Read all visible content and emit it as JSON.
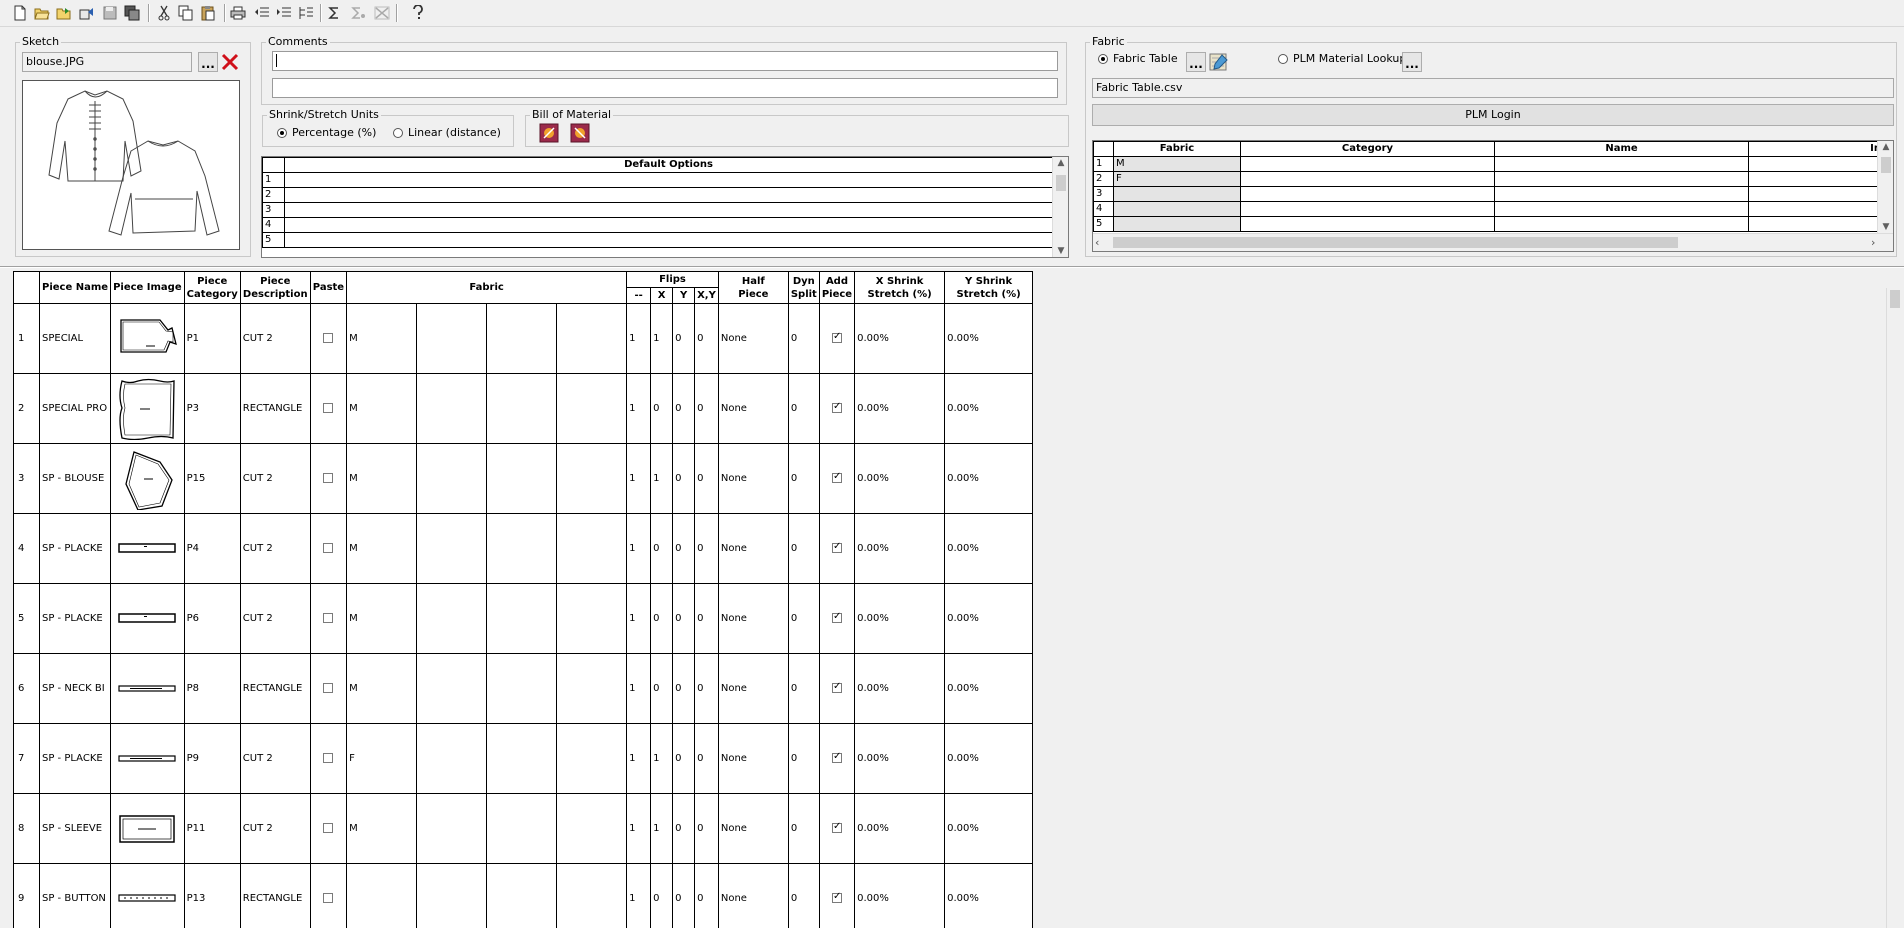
{
  "toolbar": {
    "icons": [
      "new-file-icon",
      "open-folder-icon",
      "open-recent-icon",
      "import-icon",
      "save-icon",
      "save-as-icon",
      "cut-icon",
      "copy-icon",
      "paste-icon",
      "print-icon",
      "indent-left-icon",
      "indent-right-icon",
      "tree-icon",
      "sum-icon",
      "sum-disabled-icon",
      "close-all-disabled-icon",
      "help-icon"
    ]
  },
  "sketch": {
    "legend": "Sketch",
    "file": "blouse.JPG",
    "browse_label": "...",
    "image_name": "blouse-sketch"
  },
  "comments": {
    "legend": "Comments",
    "line1": "",
    "line2": ""
  },
  "shrink": {
    "legend": "Shrink/Stretch Units",
    "options": [
      {
        "label": "Percentage (%)",
        "selected": true
      },
      {
        "label": "Linear (distance)",
        "selected": false
      }
    ]
  },
  "bom": {
    "legend": "Bill of Material",
    "icons": [
      "bom-import-icon",
      "bom-export-icon"
    ]
  },
  "default_options": {
    "header": "Default Options",
    "rows": [
      "1",
      "2",
      "3",
      "4",
      "5"
    ]
  },
  "fabric": {
    "legend": "Fabric",
    "radio_table": "Fabric Table",
    "radio_plm": "PLM Material Lookup",
    "table_selected": true,
    "file": "Fabric Table.csv",
    "plm_login": "PLM Login",
    "browse_label": "...",
    "columns": [
      "Fabric",
      "Category",
      "Name",
      "Ima"
    ],
    "rows": [
      {
        "n": "1",
        "fabric": "M"
      },
      {
        "n": "2",
        "fabric": "F"
      },
      {
        "n": "3",
        "fabric": ""
      },
      {
        "n": "4",
        "fabric": ""
      },
      {
        "n": "5",
        "fabric": ""
      }
    ]
  },
  "main": {
    "headers": {
      "piece_name": "Piece Name",
      "piece_image": "Piece Image",
      "piece_category_1": "Piece",
      "piece_category_2": "Category",
      "piece_description_1": "Piece",
      "piece_description_2": "Description",
      "paste": "Paste",
      "fabric": "Fabric",
      "flips": "Flips",
      "flip_dash": "--",
      "flip_x": "X",
      "flip_y": "Y",
      "flip_xy": "X,Y",
      "half_piece_1": "Half",
      "half_piece_2": "Piece",
      "dyn_split_1": "Dyn",
      "dyn_split_2": "Split",
      "add_piece_1": "Add",
      "add_piece_2": "Piece",
      "x_shrink_1": "X Shrink",
      "x_shrink_2": "Stretch (%)",
      "y_shrink_1": "Y Shrink",
      "y_shrink_2": "Stretch (%)"
    },
    "rows": [
      {
        "n": "1",
        "name": "SPECIAL",
        "shape": "bodice",
        "category": "P1",
        "description": "CUT 2",
        "paste": false,
        "fabric": "M",
        "f1": "1",
        "fx": "1",
        "fy": "0",
        "fxy": "0",
        "half": "None",
        "dyn": "0",
        "add": true,
        "xs": "0.00%",
        "ys": "0.00%"
      },
      {
        "n": "2",
        "name": "SPECIAL PRO",
        "shape": "rect-wavy",
        "category": "P3",
        "description": "RECTANGLE",
        "paste": false,
        "fabric": "M",
        "f1": "1",
        "fx": "0",
        "fy": "0",
        "fxy": "0",
        "half": "None",
        "dyn": "0",
        "add": true,
        "xs": "0.00%",
        "ys": "0.00%"
      },
      {
        "n": "3",
        "name": "SP - BLOUSE",
        "shape": "pentagon",
        "category": "P15",
        "description": "CUT 2",
        "paste": false,
        "fabric": "M",
        "f1": "1",
        "fx": "1",
        "fy": "0",
        "fxy": "0",
        "half": "None",
        "dyn": "0",
        "add": true,
        "xs": "0.00%",
        "ys": "0.00%"
      },
      {
        "n": "4",
        "name": "SP - PLACKE",
        "shape": "strip-thick",
        "category": "P4",
        "description": "CUT 2",
        "paste": false,
        "fabric": "M",
        "f1": "1",
        "fx": "0",
        "fy": "0",
        "fxy": "0",
        "half": "None",
        "dyn": "0",
        "add": true,
        "xs": "0.00%",
        "ys": "0.00%"
      },
      {
        "n": "5",
        "name": "SP - PLACKE",
        "shape": "strip-thick",
        "category": "P6",
        "description": "CUT 2",
        "paste": false,
        "fabric": "M",
        "f1": "1",
        "fx": "0",
        "fy": "0",
        "fxy": "0",
        "half": "None",
        "dyn": "0",
        "add": true,
        "xs": "0.00%",
        "ys": "0.00%"
      },
      {
        "n": "6",
        "name": "SP - NECK BI",
        "shape": "strip-thin",
        "category": "P8",
        "description": "RECTANGLE",
        "paste": false,
        "fabric": "M",
        "f1": "1",
        "fx": "0",
        "fy": "0",
        "fxy": "0",
        "half": "None",
        "dyn": "0",
        "add": true,
        "xs": "0.00%",
        "ys": "0.00%"
      },
      {
        "n": "7",
        "name": "SP - PLACKE",
        "shape": "strip-thin",
        "category": "P9",
        "description": "CUT 2",
        "paste": false,
        "fabric": "F",
        "f1": "1",
        "fx": "1",
        "fy": "0",
        "fxy": "0",
        "half": "None",
        "dyn": "0",
        "add": true,
        "xs": "0.00%",
        "ys": "0.00%"
      },
      {
        "n": "8",
        "name": "SP - SLEEVE",
        "shape": "rect-double",
        "category": "P11",
        "description": "CUT 2",
        "paste": false,
        "fabric": "M",
        "f1": "1",
        "fx": "1",
        "fy": "0",
        "fxy": "0",
        "half": "None",
        "dyn": "0",
        "add": true,
        "xs": "0.00%",
        "ys": "0.00%"
      },
      {
        "n": "9",
        "name": "SP - BUTTON",
        "shape": "strip-dotted",
        "category": "P13",
        "description": "RECTANGLE",
        "paste": false,
        "fabric": "",
        "f1": "1",
        "fx": "0",
        "fy": "0",
        "fxy": "0",
        "half": "None",
        "dyn": "0",
        "add": true,
        "xs": "0.00%",
        "ys": "0.00%"
      }
    ]
  }
}
